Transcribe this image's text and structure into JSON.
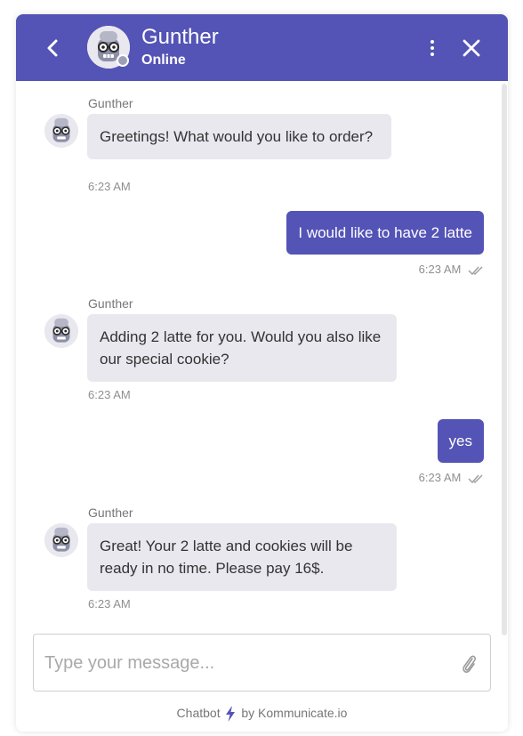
{
  "header": {
    "name": "Gunther",
    "status": "Online",
    "back_icon": "chevron-left-icon",
    "menu_icon": "vertical-ellipsis-icon",
    "close_icon": "close-icon"
  },
  "colors": {
    "brand": "#5453b6",
    "incoming_bubble": "#e9e8ef",
    "text": "#333333",
    "muted": "#8f8f8f"
  },
  "messages": [
    {
      "direction": "in",
      "sender": "Gunther",
      "text": "Greetings! What would you like to order?",
      "time": "6:23 AM"
    },
    {
      "direction": "out",
      "text": "I would like to have 2 latte",
      "time": "6:23 AM",
      "status_icon": "double-check-icon"
    },
    {
      "direction": "in",
      "sender": "Gunther",
      "text": "Adding 2 latte for you. Would you also like our special cookie?",
      "time": "6:23 AM"
    },
    {
      "direction": "out",
      "text": "yes",
      "time": "6:23 AM",
      "status_icon": "double-check-icon"
    },
    {
      "direction": "in",
      "sender": "Gunther",
      "text": "Great! Your 2 latte and cookies will be ready in no time. Please pay 16$.",
      "time": "6:23 AM"
    }
  ],
  "composer": {
    "placeholder": "Type your message...",
    "value": "",
    "attach_icon": "paperclip-icon"
  },
  "footer": {
    "prefix": "Chatbot",
    "icon": "lightning-icon",
    "suffix": "by Kommunicate.io"
  }
}
